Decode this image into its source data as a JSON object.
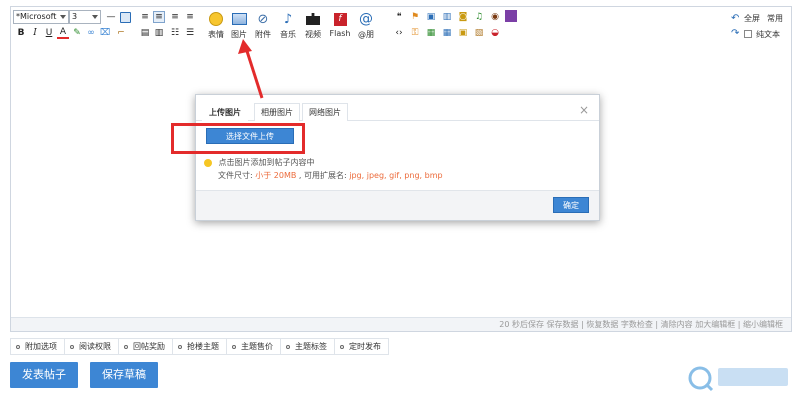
{
  "toolbar": {
    "font_family": "*Microsoft",
    "font_size": "3",
    "big_buttons": [
      {
        "label": "表情",
        "icon": "emoticon-icon"
      },
      {
        "label": "图片",
        "icon": "image-icon"
      },
      {
        "label": "附件",
        "icon": "attachment-icon"
      },
      {
        "label": "音乐",
        "icon": "music-icon"
      },
      {
        "label": "视频",
        "icon": "video-icon"
      },
      {
        "label": "Flash",
        "icon": "flash-icon"
      },
      {
        "label": "@朋",
        "icon": "at-icon"
      }
    ],
    "right": {
      "fullscreen": "全屏",
      "common": "常用",
      "plaintext": "纯文本"
    }
  },
  "dialog": {
    "tabs": [
      "上传图片",
      "相册图片",
      "网络图片"
    ],
    "upload_button": "选择文件上传",
    "hint": "点击图片添加到帖子内容中",
    "size_prefix": "文件尺寸: ",
    "size_value": "小于 20MB",
    "ext_prefix": " , 可用扩展名: ",
    "ext_value": "jpg, jpeg, gif, png, bmp",
    "ok_button": "确定"
  },
  "statusbar": "20 秒后保存 保存数据 | 恢复数据     字数检查 | 清除内容     加大编辑框 | 缩小编辑框",
  "options": [
    "附加选项",
    "阅读权限",
    "回帖奖励",
    "抢楼主题",
    "主题售价",
    "主题标签",
    "定时发布"
  ],
  "actions": {
    "publish": "发表帖子",
    "save_draft": "保存草稿"
  },
  "colors": {
    "accent": "#3d86d4",
    "highlight": "#e32b2b",
    "orange_text": "#ec6b3b"
  }
}
